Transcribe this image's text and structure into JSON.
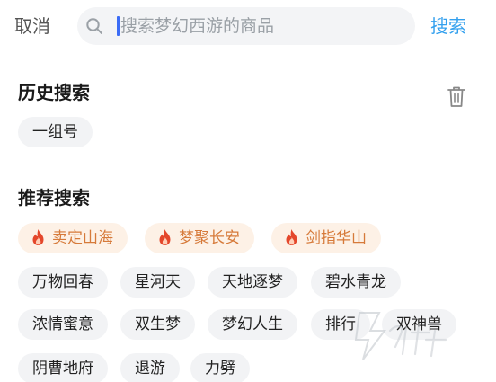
{
  "header": {
    "cancel_label": "取消",
    "search_placeholder": "搜索梦幻西游的商品",
    "search_label": "搜索"
  },
  "history": {
    "title": "历史搜索",
    "items": [
      "一组号"
    ]
  },
  "recommend": {
    "title": "推荐搜索",
    "hot_items": [
      "卖定山海",
      "梦聚长安",
      "剑指华山"
    ],
    "items": [
      "万物回春",
      "星河天",
      "天地逐梦",
      "碧水青龙",
      "浓情蜜意",
      "双生梦",
      "梦幻人生",
      "排行",
      "双神兽",
      "阴曹地府",
      "退游",
      "力劈"
    ]
  },
  "colors": {
    "accent_blue": "#33a0ee",
    "hot_chip_bg": "#fdf1e6",
    "hot_chip_text": "#d67a3a",
    "flame": "#e4472b",
    "chip_bg": "#f2f3f5"
  },
  "icons": {
    "search": "search-icon",
    "delete": "trash-icon",
    "hot": "flame-icon"
  }
}
